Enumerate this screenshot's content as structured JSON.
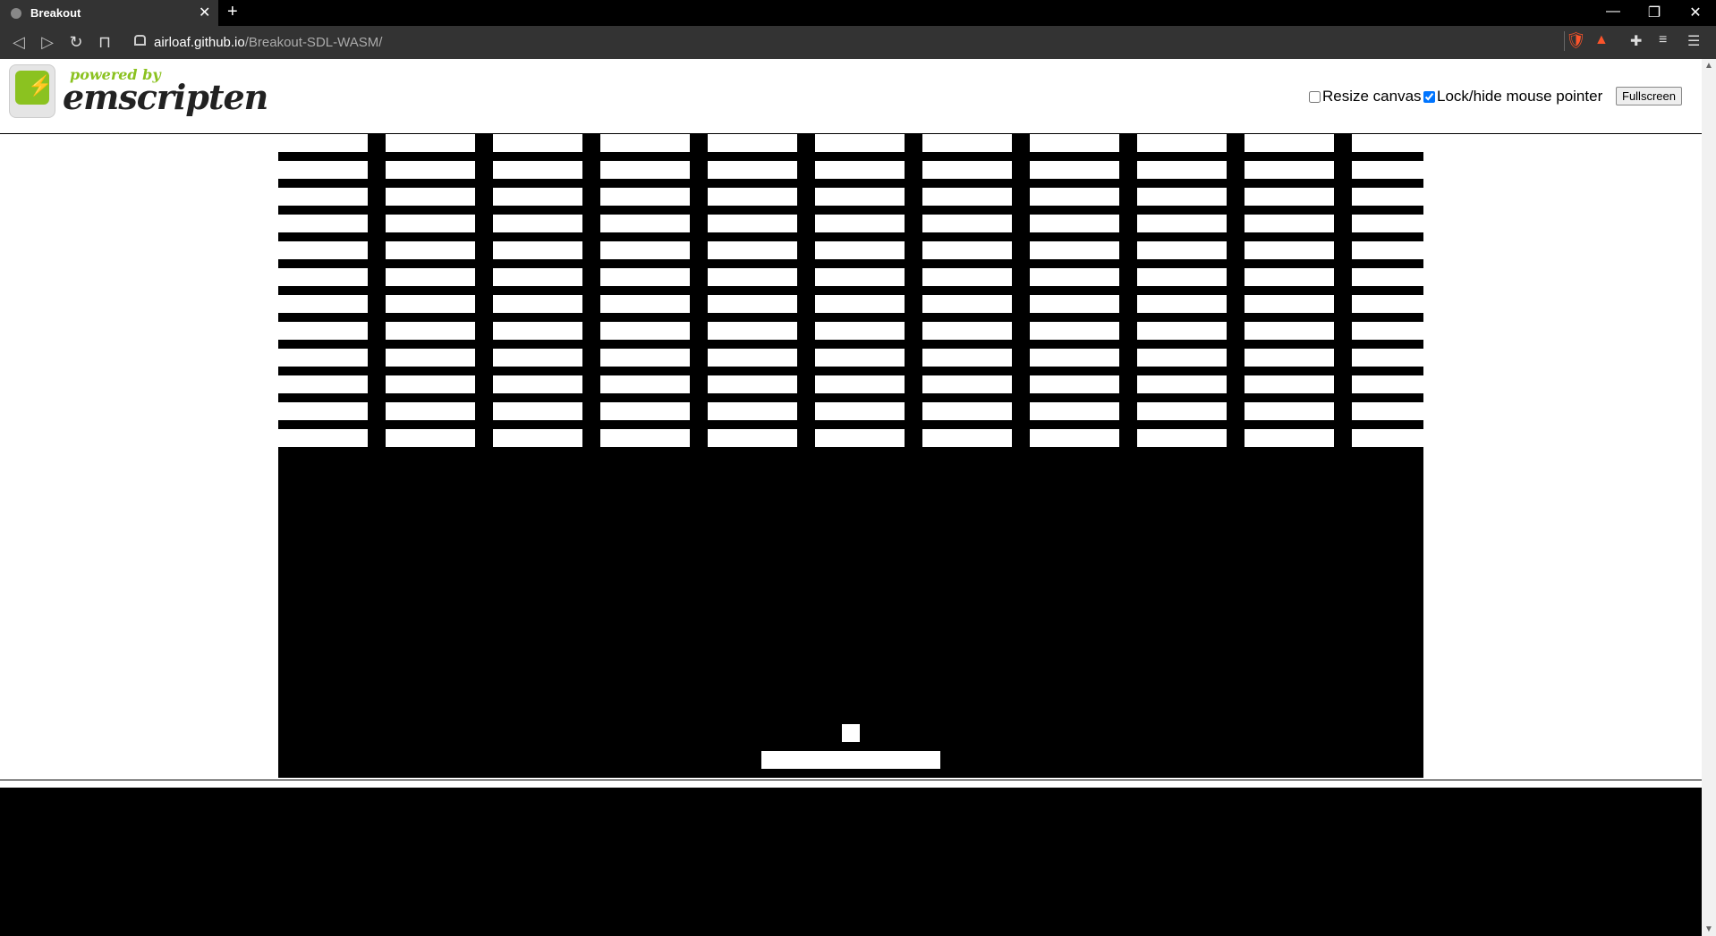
{
  "browser": {
    "tab_title": "Breakout",
    "url_host": "airloaf.github.io",
    "url_path": "/Breakout-SDL-WASM/"
  },
  "header": {
    "powered_by": "powered by",
    "brand": "emscripten",
    "resize_canvas_label": "Resize canvas",
    "resize_canvas_checked": false,
    "lock_pointer_label": "Lock/hide mouse pointer",
    "lock_pointer_checked": true,
    "fullscreen_label": "Fullscreen"
  },
  "game": {
    "name": "Breakout",
    "brick_columns": 11,
    "brick_rows": 12,
    "colors": {
      "background": "#000000",
      "bricks": "#ffffff",
      "ball": "#ffffff",
      "paddle": "#ffffff"
    }
  }
}
